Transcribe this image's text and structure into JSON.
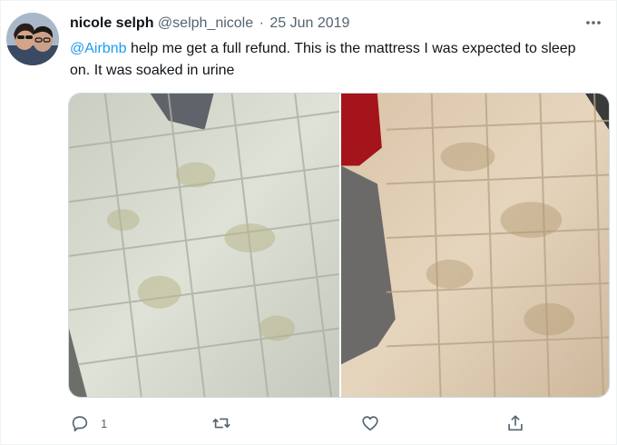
{
  "tweet": {
    "display_name": "nicole selph",
    "handle": "@selph_nicole",
    "separator": "·",
    "date": "25 Jun 2019",
    "mention": "@Airbnb",
    "text": " help me get a full refund. This is the mattress I was expected to sleep on. It was soaked in urine",
    "more_icon": "more-horizontal-icon"
  },
  "media": {
    "photos": [
      {
        "subject": "stained mattress"
      },
      {
        "subject": "stained mattress"
      }
    ]
  },
  "actions": {
    "reply_icon": "reply-icon",
    "reply_count": "1",
    "retweet_icon": "retweet-icon",
    "like_icon": "heart-icon",
    "share_icon": "share-icon"
  },
  "colors": {
    "accent": "#1d9bf0",
    "secondary_text": "#536471",
    "primary_text": "#0f1419"
  }
}
